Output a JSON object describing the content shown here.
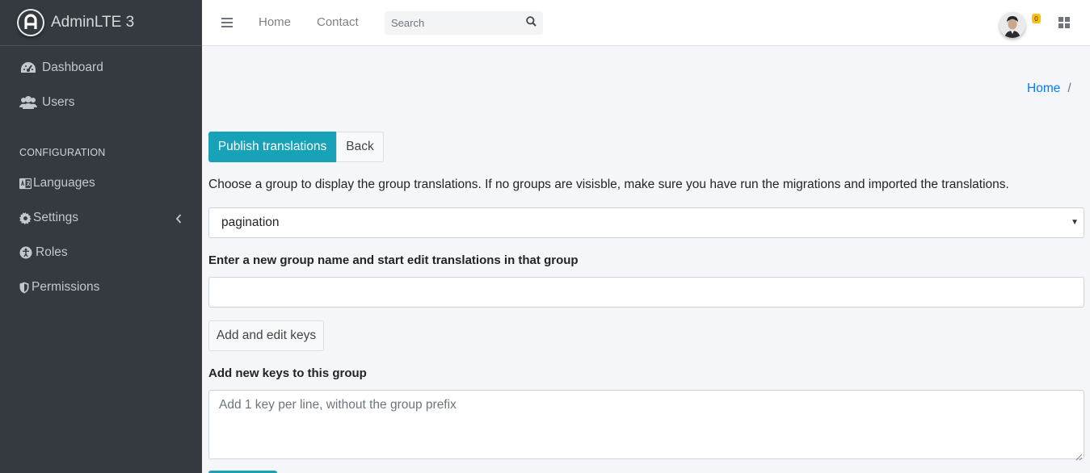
{
  "brand": {
    "name": "AdminLTE 3"
  },
  "sidebar": {
    "items": [
      {
        "label": "Dashboard",
        "icon": "tachometer-icon"
      },
      {
        "label": "Users",
        "icon": "users-icon"
      }
    ],
    "header": "CONFIGURATION",
    "config_items": [
      {
        "label": "Languages",
        "icon": "language-icon"
      },
      {
        "label": "Settings",
        "icon": "gear-icon"
      },
      {
        "label": "Roles",
        "icon": "universal-access-icon"
      },
      {
        "label": "Permissions",
        "icon": "shield-icon"
      }
    ]
  },
  "navbar": {
    "links": [
      "Home",
      "Contact"
    ],
    "search_placeholder": "Search",
    "notifications_count": "0"
  },
  "breadcrumb": {
    "home": "Home",
    "separator": "/"
  },
  "actions": {
    "publish": "Publish translations",
    "back": "Back"
  },
  "help_text": "Choose a group to display the group translations. If no groups are visisble, make sure you have run the migrations and imported the translations.",
  "group_select": {
    "selected": "pagination"
  },
  "new_group": {
    "label": "Enter a new group name and start edit translations in that group",
    "button": "Add and edit keys"
  },
  "new_keys": {
    "label": "Add new keys to this group",
    "placeholder": "Add 1 key per line, without the group prefix"
  },
  "colors": {
    "sidebar_bg": "#343a40",
    "primary_info": "#17a2b8",
    "link": "#007bff",
    "badge": "#ffc107"
  }
}
